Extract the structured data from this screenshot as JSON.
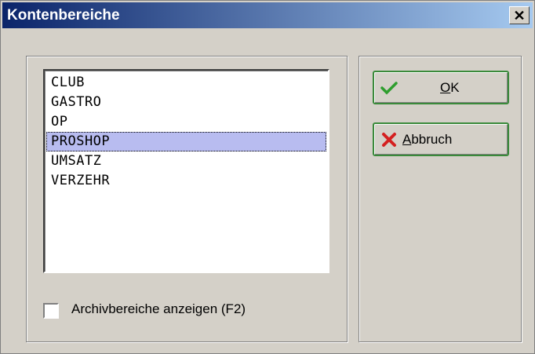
{
  "window": {
    "title": "Kontenbereiche"
  },
  "list": {
    "items": [
      "CLUB",
      "GASTRO",
      "OP",
      "PROSHOP",
      "UMSATZ",
      "VERZEHR"
    ],
    "selected_index": 3
  },
  "checkbox": {
    "label": "Archivbereiche anzeigen (F2)",
    "checked": false
  },
  "buttons": {
    "ok_label_mnemonic": "O",
    "ok_label_rest": "K",
    "cancel_label_mnemonic": "A",
    "cancel_label_rest": "bbruch"
  },
  "colors": {
    "titlebar_start": "#0a246a",
    "titlebar_end": "#a6caf0",
    "selection": "#b8bcf0",
    "button_border": "#3a8a3a",
    "ok_check": "#2e9e2e",
    "cancel_x": "#d42020"
  }
}
